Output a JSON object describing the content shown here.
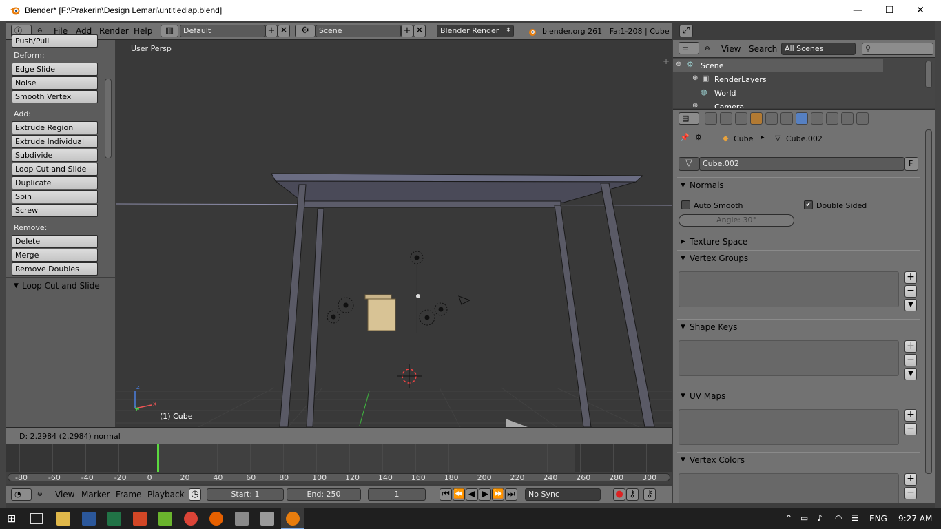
{
  "window": {
    "title": "Blender* [F:\\Prakerin\\Design Lemari\\untitledlap.blend]",
    "minimize": "—",
    "maximize": "☐",
    "close": "✕"
  },
  "info_header": {
    "menus": [
      "File",
      "Add",
      "Render",
      "Help"
    ],
    "screen_layout": "Default",
    "scene": "Scene",
    "render_engine": "Blender Render",
    "stats": "blender.org 261 | Fa:1-208 | Cube"
  },
  "tool_shelf": {
    "cut_top_label": "Push/Pull",
    "deform_label": "Deform:",
    "deform_buttons": [
      "Edge Slide",
      "Noise",
      "Smooth Vertex"
    ],
    "add_label": "Add:",
    "add_buttons": [
      "Extrude Region",
      "Extrude Individual",
      "Subdivide",
      "Loop Cut and Slide",
      "Duplicate",
      "Spin",
      "Screw"
    ],
    "remove_label": "Remove:",
    "remove_buttons": [
      "Delete",
      "Merge",
      "Remove Doubles"
    ],
    "operator_panel": "Loop Cut and Slide"
  },
  "viewport": {
    "view_label": "User Persp",
    "object_label": "(1) Cube",
    "axis_x": "x",
    "axis_y": "y",
    "axis_z": "z"
  },
  "status_line": {
    "text": "D: 2.2984 (2.2984) normal"
  },
  "timeline": {
    "ticks": [
      "-80",
      "-60",
      "-40",
      "-20",
      "0",
      "20",
      "40",
      "60",
      "80",
      "100",
      "120",
      "140",
      "160",
      "180",
      "200",
      "220",
      "240",
      "260",
      "280",
      "300"
    ],
    "current_frame_marker": 0,
    "menus": [
      "View",
      "Marker",
      "Frame",
      "Playback"
    ],
    "start": "Start: 1",
    "end": "End: 250",
    "current_frame": "1",
    "sync": "No Sync"
  },
  "outliner": {
    "menus": [
      "View",
      "Search"
    ],
    "filter": "All Scenes",
    "items": [
      {
        "label": "Scene"
      },
      {
        "label": "RenderLayers"
      },
      {
        "label": "World"
      },
      {
        "label": "Camera"
      }
    ]
  },
  "properties": {
    "breadcrumb_object": "Cube",
    "breadcrumb_data": "Cube.002",
    "mesh_name": "Cube.002",
    "fake_user": "F",
    "panels": {
      "normals": "Normals",
      "auto_smooth": "Auto Smooth",
      "double_sided": "Double Sided",
      "angle": "Angle: 30°",
      "texture_space": "Texture Space",
      "vertex_groups": "Vertex Groups",
      "shape_keys": "Shape Keys",
      "uv_maps": "UV Maps",
      "vertex_colors": "Vertex Colors"
    },
    "auto_smooth_checked": false,
    "double_sided_checked": true
  },
  "taskbar": {
    "language": "ENG",
    "time": "9:27 AM"
  },
  "colors": {
    "header": "#727272",
    "viewport_bg": "#393939",
    "accent_orange": "#e87d0d",
    "frame_marker": "#5bd940",
    "vertex_group_tab": "#5680c2"
  }
}
